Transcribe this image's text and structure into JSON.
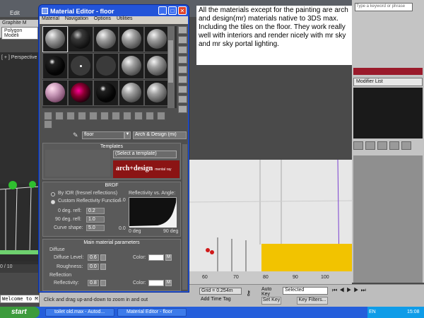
{
  "max": {
    "edit_menu": "Edit",
    "ribbon_tab": "Graphite M",
    "ribbon_sub": "Polygon Modeli",
    "viewport_label": "[ + ] Perspective",
    "timeline_pos": "0 / 10",
    "welcome": "Welcome to M",
    "search_placeholder": "Type a keyword or phrase",
    "modifier_list": "Modifier List",
    "trackbar_ticks": [
      "60",
      "70",
      "80",
      "90",
      "100"
    ],
    "grid": "Grid = 0.254m",
    "add_time_tag": "Add Time Tag",
    "auto_key": "Auto Key",
    "selection_dropdown": "Selected",
    "set_key": "Set Key",
    "key_filters": "Key Filters...",
    "status_message": "Click and drag up-and-down to zoom in and out"
  },
  "taskbar": {
    "start": "start",
    "task1": "toilet old.max - Autod...",
    "task2": "Material Editor - floor",
    "lang": "EN",
    "clock": "15:08"
  },
  "note": {
    "text": "All the materials except for the painting are arch and design(mr) materials native to 3DS max. Including the tiles on the floor.  They work really well with interiors and render nicely with mr sky and mr sky portal lighting."
  },
  "editor": {
    "title": "Material Editor - floor",
    "menu": [
      "Material",
      "Navigation",
      "Options",
      "Utilities"
    ],
    "material_name": "floor",
    "material_type": "Arch & Design (mi)",
    "templates_header": "Templates",
    "template_select": "(Select a template)",
    "banner_main": "arch+design",
    "banner_sub": "mental ray",
    "brdf_header": "BRDF",
    "by_ior": "By IOR (fresnel reflections)",
    "custom_func": "Custom Reflectivity Function",
    "deg0_label": "0 deg. refl:",
    "deg0_value": "0.2",
    "deg90_label": "90 deg. refl:",
    "deg90_value": "1.0",
    "curve_label": "Curve shape:",
    "curve_value": "5.0",
    "graph_title": "Reflectivity vs. Angle:",
    "graph_y_top": "1.0",
    "graph_y_bottom": "0.0",
    "graph_x_left": "0 deg",
    "graph_x_right": "90 deg",
    "main_params_header": "Main material parameters",
    "diffuse_label": "Diffuse",
    "diffuse_level_label": "Diffuse Level:",
    "diffuse_level_value": "0.6",
    "color_label": "Color:",
    "roughness_label": "Roughness:",
    "roughness_value": "0.0",
    "reflection_label": "Reflection",
    "reflectivity_label": "Reflectivity:",
    "reflectivity_value": "0.8",
    "m_button": "M"
  }
}
